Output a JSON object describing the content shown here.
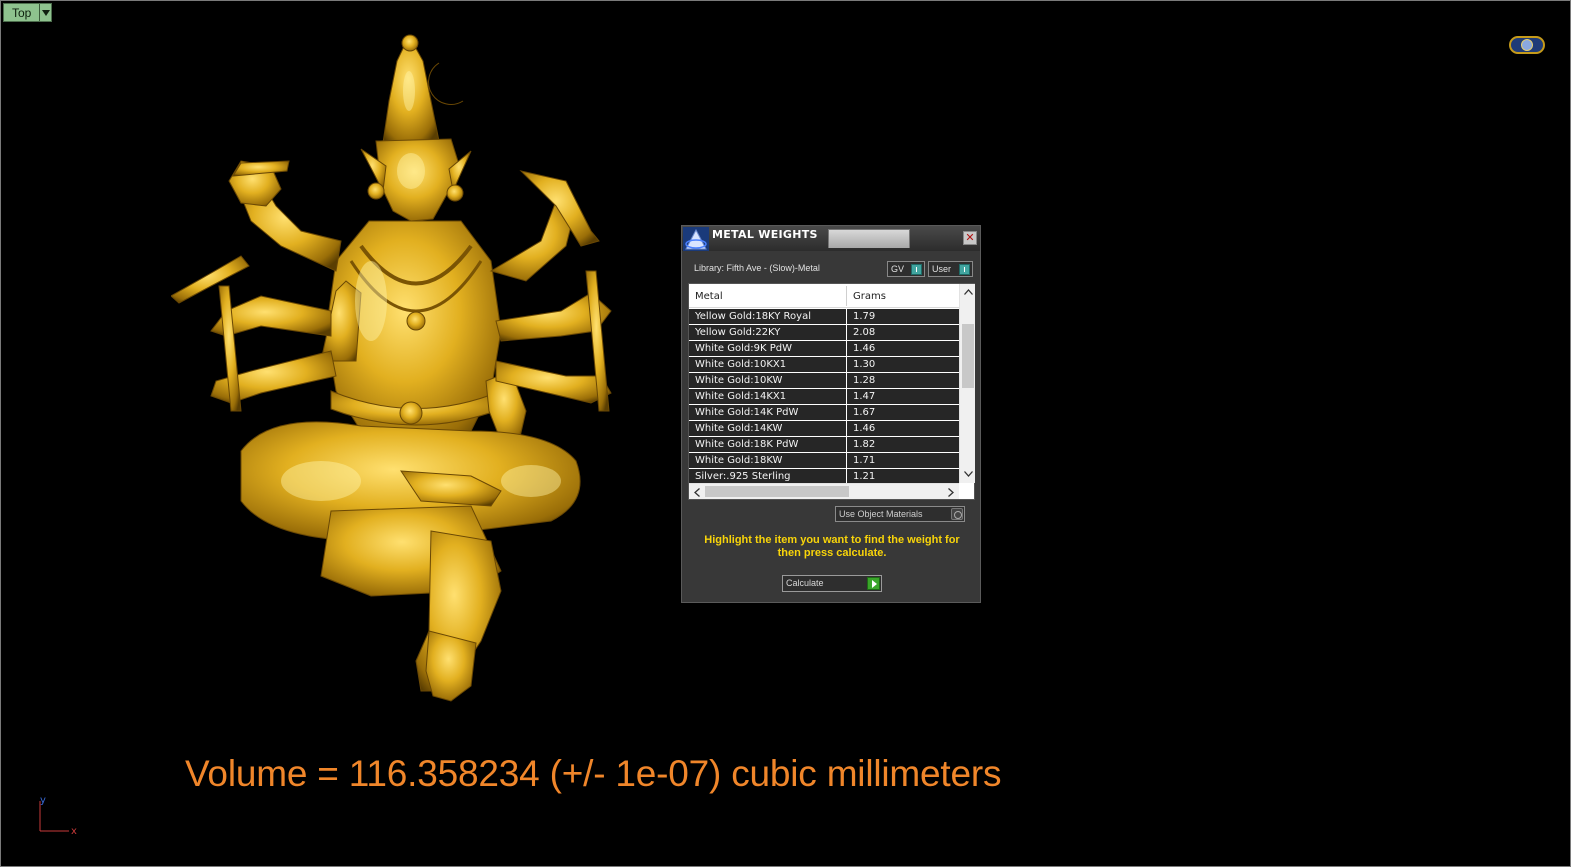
{
  "viewport": {
    "view_name": "Top",
    "volume_readout": "Volume = 116.358234 (+/- 1e-07) cubic millimeters",
    "axis_y": "y",
    "axis_x": "x",
    "colors": {
      "background": "#000000",
      "readout": "#f0862a",
      "model": "#d4a418"
    }
  },
  "panel": {
    "title": "METAL WEIGHTS",
    "library_label": "Library: Fifth Ave - (Slow)-Metal",
    "gv_label": "GV",
    "user_label": "User",
    "table": {
      "headers": [
        "Metal",
        "Grams"
      ],
      "rows": [
        [
          "Yellow Gold:18KY Royal",
          "1.79"
        ],
        [
          "Yellow Gold:22KY",
          "2.08"
        ],
        [
          "White Gold:9K PdW",
          "1.46"
        ],
        [
          "White Gold:10KX1",
          "1.30"
        ],
        [
          "White Gold:10KW",
          "1.28"
        ],
        [
          "White Gold:14KX1",
          "1.47"
        ],
        [
          "White Gold:14K PdW",
          "1.67"
        ],
        [
          "White Gold:14KW",
          "1.46"
        ],
        [
          "White Gold:18K PdW",
          "1.82"
        ],
        [
          "White Gold:18KW",
          "1.71"
        ],
        [
          "Silver:.925 Sterling",
          "1.21"
        ]
      ]
    },
    "use_materials_label": "Use Object Materials",
    "hint": "Highlight the item you want to find the weight for then press calculate.",
    "calculate_label": "Calculate",
    "colors": {
      "hint": "#f8d40a",
      "calc_indicator": "#3aa62a",
      "toggle_indicator": "#41a5a0"
    }
  }
}
